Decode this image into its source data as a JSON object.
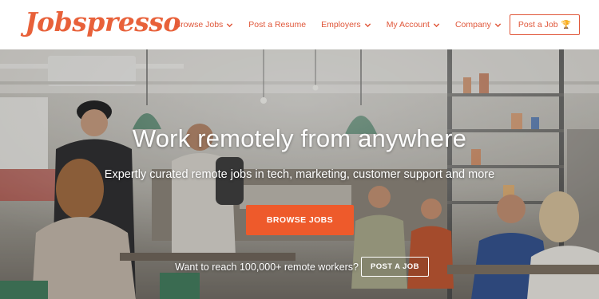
{
  "brand": {
    "logo_text": "Jobspresso",
    "accent_color": "#e0573a",
    "button_color": "#ee5a2b"
  },
  "nav": {
    "items": [
      {
        "label": "Browse Jobs",
        "has_dropdown": true
      },
      {
        "label": "Post a Resume",
        "has_dropdown": false
      },
      {
        "label": "Employers",
        "has_dropdown": true
      },
      {
        "label": "My Account",
        "has_dropdown": true
      },
      {
        "label": "Company",
        "has_dropdown": true
      }
    ],
    "post_job_label": "Post a Job",
    "post_job_icon": "trophy-icon"
  },
  "hero": {
    "title": "Work remotely from anywhere",
    "subtitle": "Expertly curated remote jobs in tech, marketing, customer support and more",
    "browse_button_label": "BROWSE JOBS",
    "reach_text": "Want to reach 100,000+ remote workers?",
    "post_job_button_label": "POST A JOB",
    "background_image": "cafe-coworking-photo"
  }
}
